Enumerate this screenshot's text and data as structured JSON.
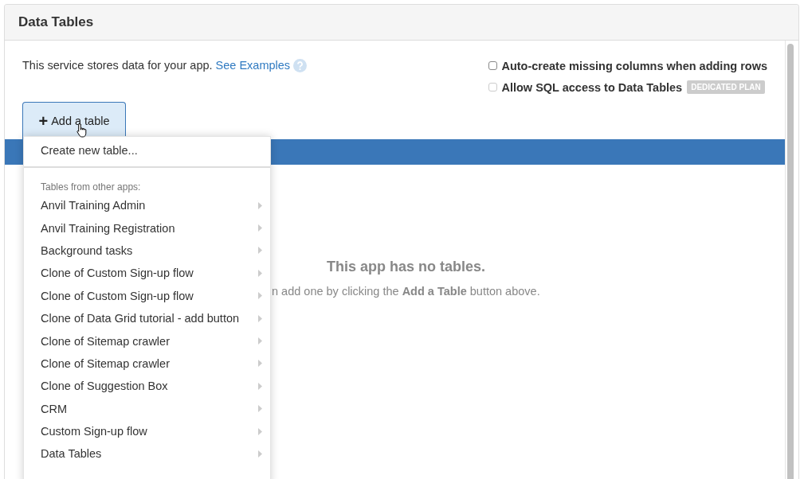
{
  "panel": {
    "title": "Data Tables"
  },
  "intro": {
    "text": "This service stores data for your app.",
    "link": "See Examples"
  },
  "options": [
    {
      "label": "Auto-create missing columns when adding rows",
      "checked": false,
      "disabled": false
    },
    {
      "label": "Allow SQL access to Data Tables",
      "checked": false,
      "disabled": true,
      "badge": "DEDICATED PLAN"
    }
  ],
  "add_button": {
    "icon": "+",
    "label": "Add a table",
    "expanded": true
  },
  "menu": {
    "create_item": "Create new table...",
    "section_label": "Tables from other apps:",
    "apps": [
      "Anvil Training Admin",
      "Anvil Training Registration",
      "Background tasks",
      "Clone of Custom Sign-up flow",
      "Clone of Custom Sign-up flow",
      "Clone of Data Grid tutorial - add button",
      "Clone of Sitemap crawler",
      "Clone of Sitemap crawler",
      "Clone of Suggestion Box",
      "CRM",
      "Custom Sign-up flow",
      "Data Tables"
    ]
  },
  "empty_state": {
    "title": "This app has no tables.",
    "message": "n add one by clicking the **Add a Table** button above."
  }
}
